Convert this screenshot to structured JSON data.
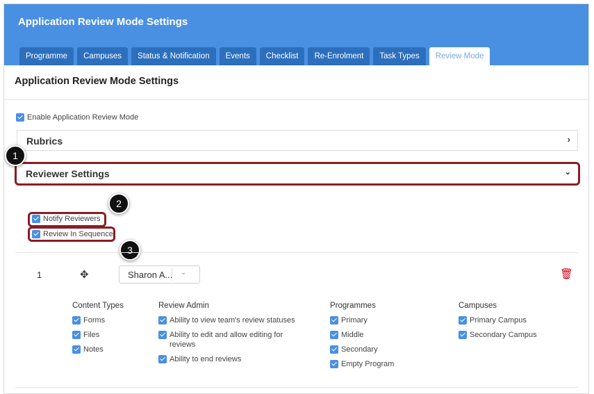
{
  "header": {
    "title": "Application Review Mode Settings",
    "tabs": [
      {
        "label": "Programme"
      },
      {
        "label": "Campuses"
      },
      {
        "label": "Status & Notification"
      },
      {
        "label": "Events"
      },
      {
        "label": "Checklist"
      },
      {
        "label": "Re-Enrolment"
      },
      {
        "label": "Task Types"
      },
      {
        "label": "Review Mode",
        "active": true
      }
    ]
  },
  "section_title": "Application Review Mode Settings",
  "enable_review_mode": {
    "label": "Enable Application Review Mode",
    "checked": true
  },
  "accordions": {
    "rubrics": {
      "title": "Rubrics",
      "icon": "chevron-right-icon"
    },
    "reviewer_settings": {
      "title": "Reviewer Settings",
      "icon": "chevron-down-icon"
    }
  },
  "reviewer_options": {
    "notify": {
      "label": "Notify Reviewers",
      "checked": true
    },
    "sequence": {
      "label": "Review In Sequence",
      "checked": true
    }
  },
  "callouts": [
    "1",
    "2",
    "3"
  ],
  "reviewer": {
    "order": "1",
    "name": "Sharon A...",
    "content_types": {
      "heading": "Content Types",
      "items": [
        "Forms",
        "Files",
        "Notes"
      ]
    },
    "review_admin": {
      "heading": "Review Admin",
      "items": [
        "Ability to view team's review statuses",
        "Ability to edit and allow editing for reviews",
        "Ability to end reviews"
      ]
    },
    "programmes": {
      "heading": "Programmes",
      "items": [
        "Primary",
        "Middle",
        "Secondary",
        "Empty Program"
      ]
    },
    "campuses": {
      "heading": "Campuses",
      "items": [
        "Primary Campus",
        "Secondary Campus"
      ]
    }
  },
  "colors": {
    "accent": "#4a90e2",
    "tab": "#2c6fbd",
    "highlight": "#8b1c24",
    "delete": "#d0021b"
  }
}
